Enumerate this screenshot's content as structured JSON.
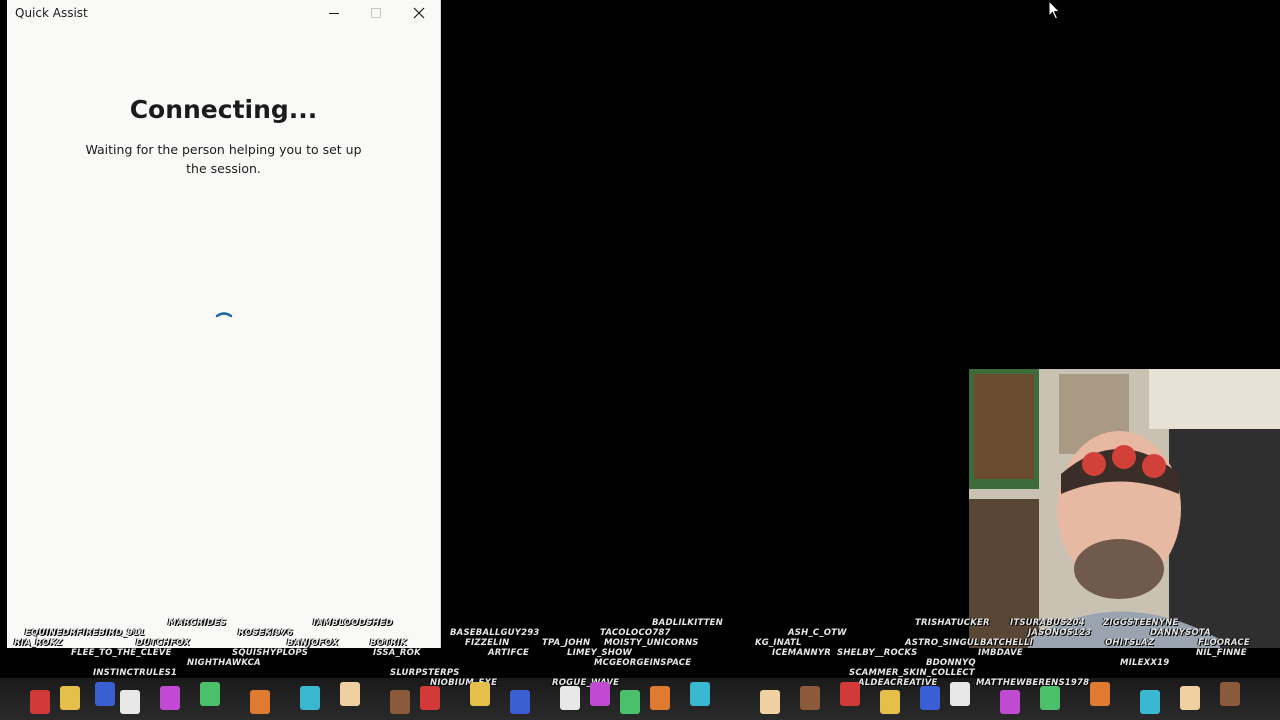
{
  "window": {
    "title": "Quick Assist",
    "minimize_icon": "minimize-icon",
    "maximize_icon": "maximize-icon",
    "close_icon": "close-icon"
  },
  "main": {
    "heading": "Connecting...",
    "message": "Waiting for the person helping you to set up the session.",
    "spinner_icon": "loading-spinner-icon",
    "accent_color": "#1a5fa8"
  },
  "stream_overlay": {
    "viewer_names": [
      "EQUINEDRFIREBIRD_911",
      "RIA_ROKZ",
      "DUTCHFOX",
      "MARCRIDES",
      "ROSEKI976",
      "IAMBLOODSHED",
      "FLEE_TO_THE_CLEVE",
      "NIGHTHAWKCA",
      "SQUISHYPLOPS",
      "BANJOFOX",
      "BOTRIK",
      "ISSA_ROK",
      "INSTINCTRULES1",
      "SLURPSTERPS",
      "BASEBALLGUY293",
      "FIZZELIN",
      "ARTIFCE",
      "NIOBIUM_EXE",
      "BADLILKITTEN",
      "TACOLOCO787",
      "TPA_JOHN",
      "MOISTY_UNICORNS",
      "LIMEY_SHOW",
      "MCGEORGEINSPACE",
      "ROGUE_WAVE",
      "ASH_C_OTW",
      "KG_INATL",
      "ICEMANNYR",
      "SHELBY__ROCKS",
      "SCAMMER_SKIN_COLLECT",
      "ALDEACREATIVE",
      "TRISHATUCKER",
      "ASTRO_SINGULAR",
      "BATCHELLI",
      "IMBDAVE",
      "BDONNYQ",
      "ITSURABUS204",
      "JASONOS123",
      "ZIGGSTEENYNE",
      "DANNYSOTA",
      "OHITSLAZ",
      "FLOORACE",
      "NIL_FINNE",
      "MILEXX19",
      "MATTHEWBERENS1978"
    ]
  }
}
